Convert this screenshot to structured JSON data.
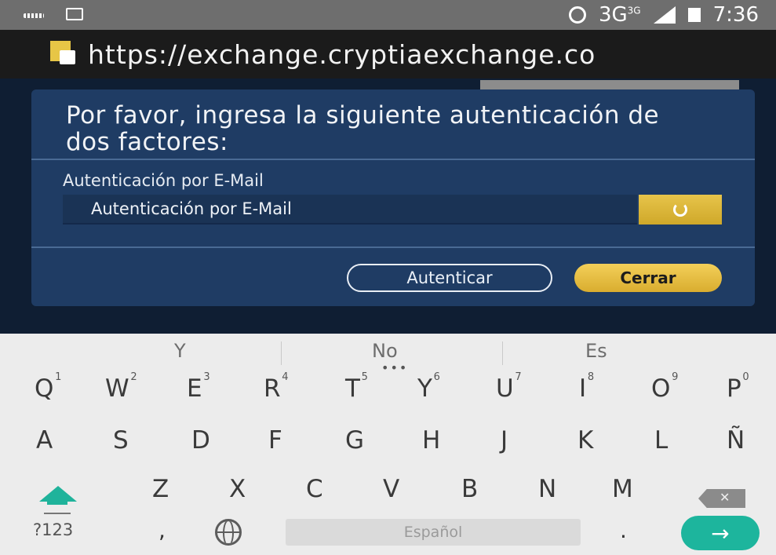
{
  "status_bar": {
    "network": "3G",
    "network_sup": "3G",
    "time": "7:36"
  },
  "browser": {
    "url": "https://exchange.cryptiaexchange.co"
  },
  "modal": {
    "title": "Por favor, ingresa la siguiente autenticación de dos factores:",
    "field_label": "Autenticación por E-Mail",
    "field_value": "Autenticación por E-Mail",
    "authenticate_label": "Autenticar",
    "close_label": "Cerrar"
  },
  "keyboard": {
    "suggestions": [
      "Y",
      "No",
      "Es"
    ],
    "more": "•••",
    "row1": [
      {
        "key": "Q",
        "alt": "1"
      },
      {
        "key": "W",
        "alt": "2"
      },
      {
        "key": "E",
        "alt": "3"
      },
      {
        "key": "R",
        "alt": "4"
      },
      {
        "key": "T",
        "alt": "5"
      },
      {
        "key": "Y",
        "alt": "6"
      },
      {
        "key": "U",
        "alt": "7"
      },
      {
        "key": "I",
        "alt": "8"
      },
      {
        "key": "O",
        "alt": "9"
      },
      {
        "key": "P",
        "alt": "0"
      }
    ],
    "row2": [
      "A",
      "S",
      "D",
      "F",
      "G",
      "H",
      "J",
      "K",
      "L",
      "Ñ"
    ],
    "row3": [
      "Z",
      "X",
      "C",
      "V",
      "B",
      "N",
      "M"
    ],
    "symbols_label": "?123",
    "comma": ",",
    "space_label": "Español",
    "period": ".",
    "enter_symbol": "→",
    "backspace_symbol": "✕"
  },
  "colors": {
    "accent_gold": "#e7c44a",
    "modal_blue": "#1f3c64",
    "enter_teal": "#1db59d"
  }
}
